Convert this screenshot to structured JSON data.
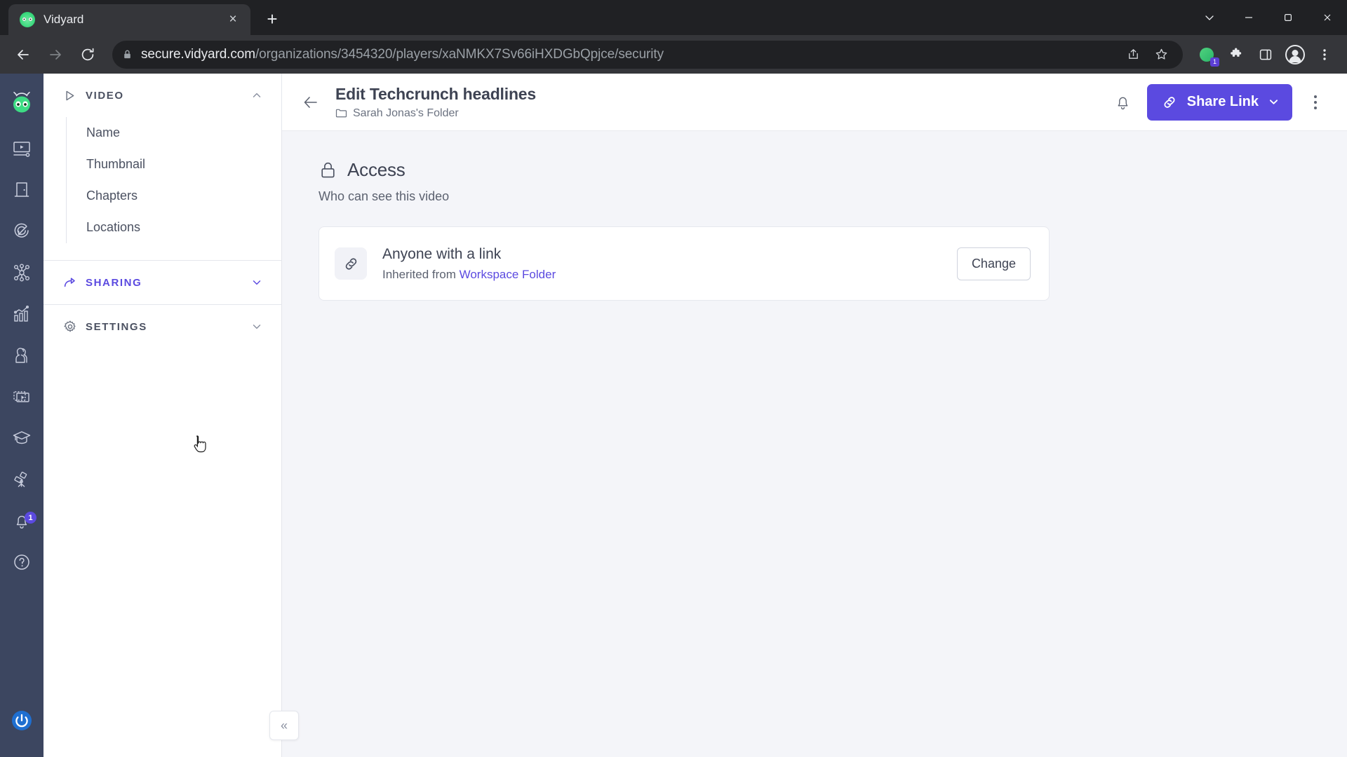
{
  "browser": {
    "tab": {
      "title": "Vidyard",
      "favicon": "vidyard-logo-icon",
      "close": "×"
    },
    "new_tab_label": "+",
    "window_controls": {
      "minimize_more": "∨",
      "minimize": "—",
      "maximize": "❐",
      "close": "✕"
    },
    "nav": {
      "back": "←",
      "forward": "→",
      "reload": "⟳"
    },
    "omnibox": {
      "lock_icon": "lock-icon",
      "url_domain": "secure.vidyard.com",
      "url_path": "/organizations/3454320/players/xaNMKX7Sv66iHXDGbQpjce/security",
      "share_icon": "share-icon",
      "bookmark_icon": "star-icon"
    },
    "toolbar_right": {
      "extension_badge": "1",
      "puzzle_icon": "extensions-icon",
      "sidepanel_icon": "side-panel-icon",
      "profile_icon": "profile-avatar-icon",
      "menu_icon": "three-dot-menu-icon"
    }
  },
  "rail": {
    "logo": "vidyard-logo",
    "items": [
      {
        "name": "videos",
        "icon": "video-player-icon"
      },
      {
        "name": "rooms",
        "icon": "door-icon"
      },
      {
        "name": "prospecting",
        "icon": "target-arrow-icon"
      },
      {
        "name": "integrations",
        "icon": "network-nodes-icon"
      },
      {
        "name": "analytics",
        "icon": "bar-chart-icon"
      },
      {
        "name": "contacts",
        "icon": "people-icon"
      },
      {
        "name": "playlists",
        "icon": "video-library-icon"
      },
      {
        "name": "learning",
        "icon": "graduation-cap-icon"
      },
      {
        "name": "discover",
        "icon": "telescope-icon"
      },
      {
        "name": "notifications",
        "icon": "bell-icon",
        "badge": "1"
      },
      {
        "name": "help",
        "icon": "question-mark-icon"
      }
    ],
    "bottom": {
      "name": "power-logout",
      "icon": "power-icon"
    }
  },
  "navpanel": {
    "sections": [
      {
        "label": "VIDEO",
        "icon": "play-triangle-icon",
        "expanded": true,
        "chevron": "chevron-up-icon",
        "items": [
          {
            "label": "Name"
          },
          {
            "label": "Thumbnail"
          },
          {
            "label": "Chapters"
          },
          {
            "label": "Locations"
          }
        ]
      },
      {
        "label": "SHARING",
        "icon": "share-arrow-icon",
        "expanded": false,
        "active": true,
        "chevron": "chevron-down-icon",
        "items": []
      },
      {
        "label": "SETTINGS",
        "icon": "gear-icon",
        "expanded": false,
        "chevron": "chevron-down-icon",
        "items": []
      }
    ],
    "collapse_label": "«"
  },
  "topbar": {
    "back_icon": "back-arrow-icon",
    "title": "Edit Techcrunch headlines",
    "folder_icon": "folder-icon",
    "folder": "Sarah Jonas's Folder",
    "bell_icon": "bell-icon",
    "share_link_label": "Share Link",
    "share_link_icon": "link-icon",
    "share_link_chevron": "chevron-down-icon",
    "more_icon": "three-dot-menu-icon"
  },
  "main": {
    "section_icon": "lock-icon",
    "section_title": "Access",
    "section_subtitle": "Who can see this video",
    "card": {
      "icon": "link-chain-icon",
      "title": "Anyone with a link",
      "inherited_prefix": "Inherited from ",
      "inherited_link": "Workspace Folder",
      "change_label": "Change"
    }
  },
  "colors": {
    "brand_purple": "#5b4ae0",
    "rail_bg": "#3c4660",
    "page_bg": "#f4f5f9",
    "text_dark": "#3e4353",
    "text_muted": "#5c6270"
  }
}
